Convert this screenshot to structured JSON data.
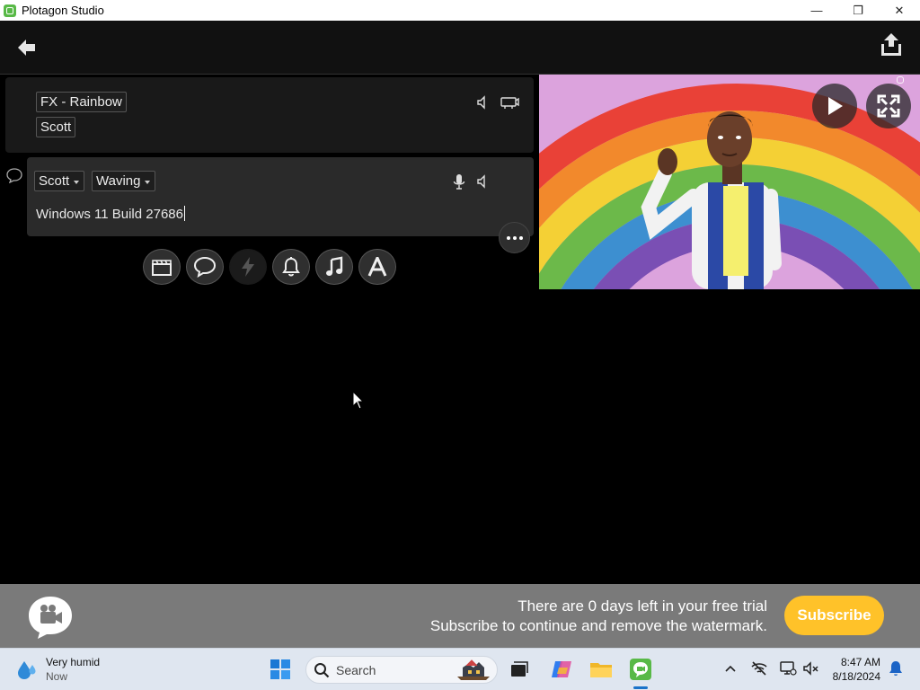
{
  "window": {
    "title": "Plotagon Studio",
    "controls": {
      "minimize": "—",
      "restore": "❐",
      "close": "✕"
    }
  },
  "scene_line": {
    "tags": [
      "FX - Rainbow",
      "Scott"
    ]
  },
  "dialogue_line": {
    "character": "Scott",
    "action": "Waving",
    "text": "Windows 11 Build 27686"
  },
  "toolbar": {
    "buttons": [
      "scene-icon",
      "dialogue-icon",
      "action-icon",
      "sound-effect-icon",
      "music-icon",
      "text-icon"
    ]
  },
  "trial": {
    "line1": "There are 0 days left in your free trial",
    "line2": "Subscribe to continue and remove the watermark.",
    "subscribe_label": "Subscribe"
  },
  "taskbar": {
    "weather_title": "Very humid",
    "weather_sub": "Now",
    "search_placeholder": "Search",
    "time": "8:47 AM",
    "date": "8/18/2024"
  },
  "colors": {
    "accent_yellow": "#ffc229",
    "brand_green": "#58b947",
    "banner_gray": "#7a7a7a"
  }
}
